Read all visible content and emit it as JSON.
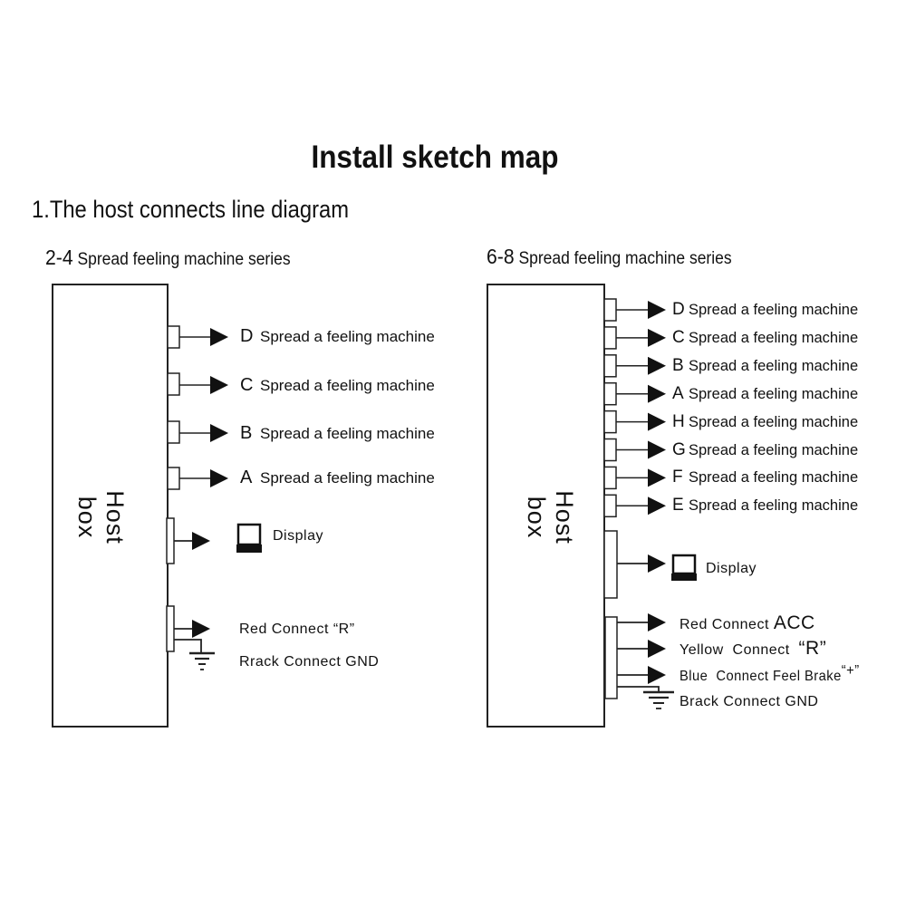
{
  "title": "Install sketch map",
  "subtitle": "1.The host connects line diagram",
  "panels": {
    "left": {
      "series_num": "2-4",
      "series_text": "Spread feeling machine series",
      "host_label": "Host box",
      "outputs": [
        {
          "letter": "D",
          "text": "Spread a feeling machine"
        },
        {
          "letter": "C",
          "text": "Spread a feeling machine"
        },
        {
          "letter": "B",
          "text": "Spread a feeling machine"
        },
        {
          "letter": "A",
          "text": "Spread a feeling machine"
        }
      ],
      "display_label": "Display",
      "wires": [
        {
          "text": "Red Connect “R”"
        },
        {
          "text": "Rrack  Connect  GND"
        }
      ]
    },
    "right": {
      "series_num": "6-8",
      "series_text": "Spread feeling machine series",
      "host_label": "Host box",
      "outputs": [
        {
          "letter": "D",
          "text": "Spread a feeling machine"
        },
        {
          "letter": "C",
          "text": "Spread a feeling machine"
        },
        {
          "letter": "B",
          "text": "Spread a feeling machine"
        },
        {
          "letter": "A",
          "text": "Spread a feeling machine"
        },
        {
          "letter": "H",
          "text": "Spread a feeling machine"
        },
        {
          "letter": "G",
          "text": "Spread a feeling machine"
        },
        {
          "letter": "F",
          "text": "Spread a feeling machine"
        },
        {
          "letter": "E",
          "text": "Spread a feeling machine"
        }
      ],
      "display_label": "Display",
      "wires": [
        {
          "prefix": "Red Connect ",
          "suffix": "ACC"
        },
        {
          "prefix": "Yellow  Connect  ",
          "suffix": "“R”"
        },
        {
          "prefix": "Blue  Connect Feel Brake",
          "suffix": "“+”"
        },
        {
          "prefix": "Brack Connect GND",
          "suffix": ""
        }
      ]
    }
  }
}
